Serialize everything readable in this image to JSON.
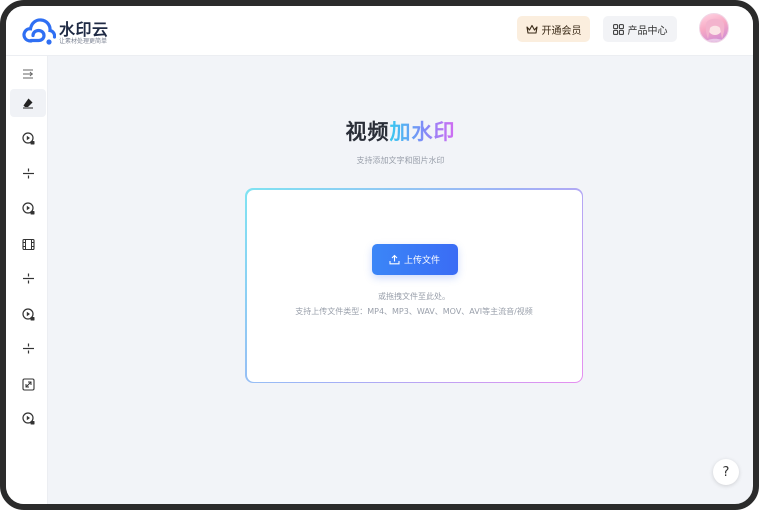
{
  "brand": {
    "name": "水印云",
    "slogan": "让素材处理更简单",
    "accent": "#2f6ff3"
  },
  "header": {
    "vip_label": "开通会员",
    "vip_icon": "crown-icon",
    "product_label": "产品中心",
    "product_icon": "grid-icon"
  },
  "sidebar": {
    "items": [
      {
        "icon": "menu-collapse-icon"
      },
      {
        "icon": "eraser-icon",
        "active": true
      },
      {
        "icon": "play-ai-icon"
      },
      {
        "icon": "divide-icon"
      },
      {
        "icon": "play-ai-icon"
      },
      {
        "icon": "film-icon"
      },
      {
        "icon": "divide-icon"
      },
      {
        "icon": "play-ai-icon"
      },
      {
        "icon": "divide-icon"
      },
      {
        "icon": "resize-icon"
      },
      {
        "icon": "play-ai-icon"
      }
    ]
  },
  "main": {
    "title_part1": "视频",
    "title_part2": "加水印",
    "subtitle": "支持添加文字和图片水印",
    "upload_label": "上传文件",
    "drag_hint": "或拖拽文件至此处。",
    "formats": "支持上传文件类型：MP4、MP3、WAV、MOV、AVI等主流音/视频"
  },
  "help_label": "?"
}
